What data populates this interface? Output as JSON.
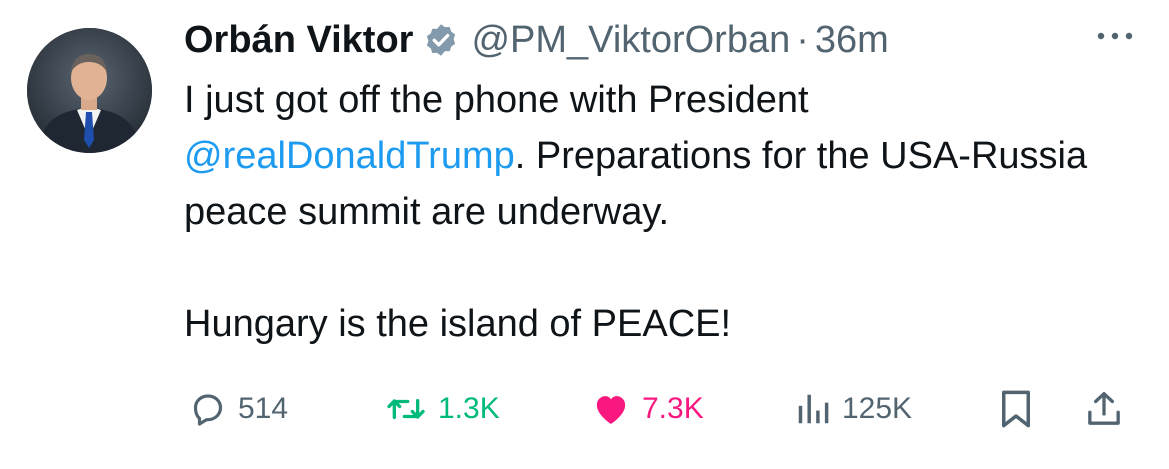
{
  "author": {
    "display_name": "Orbán Viktor",
    "handle": "@PM_ViktorOrban",
    "separator": "·",
    "time": "36m",
    "verified_icon": "verified-badge-icon"
  },
  "tweet": {
    "line1_text": "I just got off the phone with President",
    "mention": "@realDonaldTrump",
    "line2_rest": ". Preparations for the USA-Russia peace summit are underway.",
    "line3_text": "Hungary is the island of PEACE!"
  },
  "actions": {
    "reply_count": "514",
    "retweet_count": "1.3K",
    "like_count": "7.3K",
    "views_count": "125K"
  },
  "colors": {
    "text": "#0f1419",
    "muted": "#536471",
    "link": "#1d9bf0",
    "retweet": "#00ba7c",
    "like": "#f91880"
  }
}
